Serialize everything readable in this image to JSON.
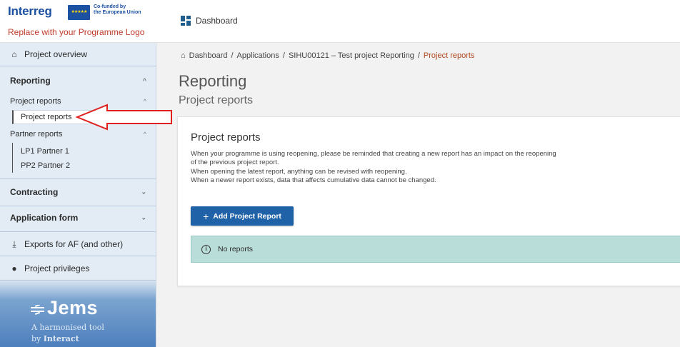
{
  "header": {
    "brand": "Interreg",
    "cofunded_line1": "Co-funded by",
    "cofunded_line2": "the European Union",
    "logo_placeholder": "Replace with your Programme Logo",
    "dashboard_label": "Dashboard"
  },
  "sidebar": {
    "project_overview": "Project overview",
    "reporting": "Reporting",
    "project_reports_group": "Project reports",
    "project_reports_item": "Project reports",
    "partner_reports_group": "Partner reports",
    "partners": [
      "LP1 Partner 1",
      "PP2 Partner 2"
    ],
    "contracting": "Contracting",
    "application_form": "Application form",
    "exports": "Exports for AF (and other)",
    "privileges": "Project privileges",
    "jems_name": "Jems",
    "jems_tag1": "A harmonised tool",
    "jems_tag2_prefix": "by ",
    "jems_tag2_bold": "Interact"
  },
  "breadcrumb": {
    "items": [
      "Dashboard",
      "Applications",
      "SIHU00121 – Test project Reporting"
    ],
    "current": "Project reports"
  },
  "page": {
    "title": "Reporting",
    "subtitle": "Project reports"
  },
  "card": {
    "title": "Project reports",
    "lines": [
      "When your programme is using reopening, please be reminded that creating a new report has an impact on the reopening",
      "of the previous project report.",
      "When opening the latest report, anything can be revised with reopening.",
      "When a newer report exists, data that affects cumulative data cannot be changed."
    ],
    "add_button": "Add Project Report",
    "empty_message": "No reports"
  },
  "colors": {
    "primary": "#1f62a8",
    "alert_bg": "#b9ddd9",
    "annotation_arrow": "#e02020",
    "breadcrumb_current": "#b0451f"
  }
}
